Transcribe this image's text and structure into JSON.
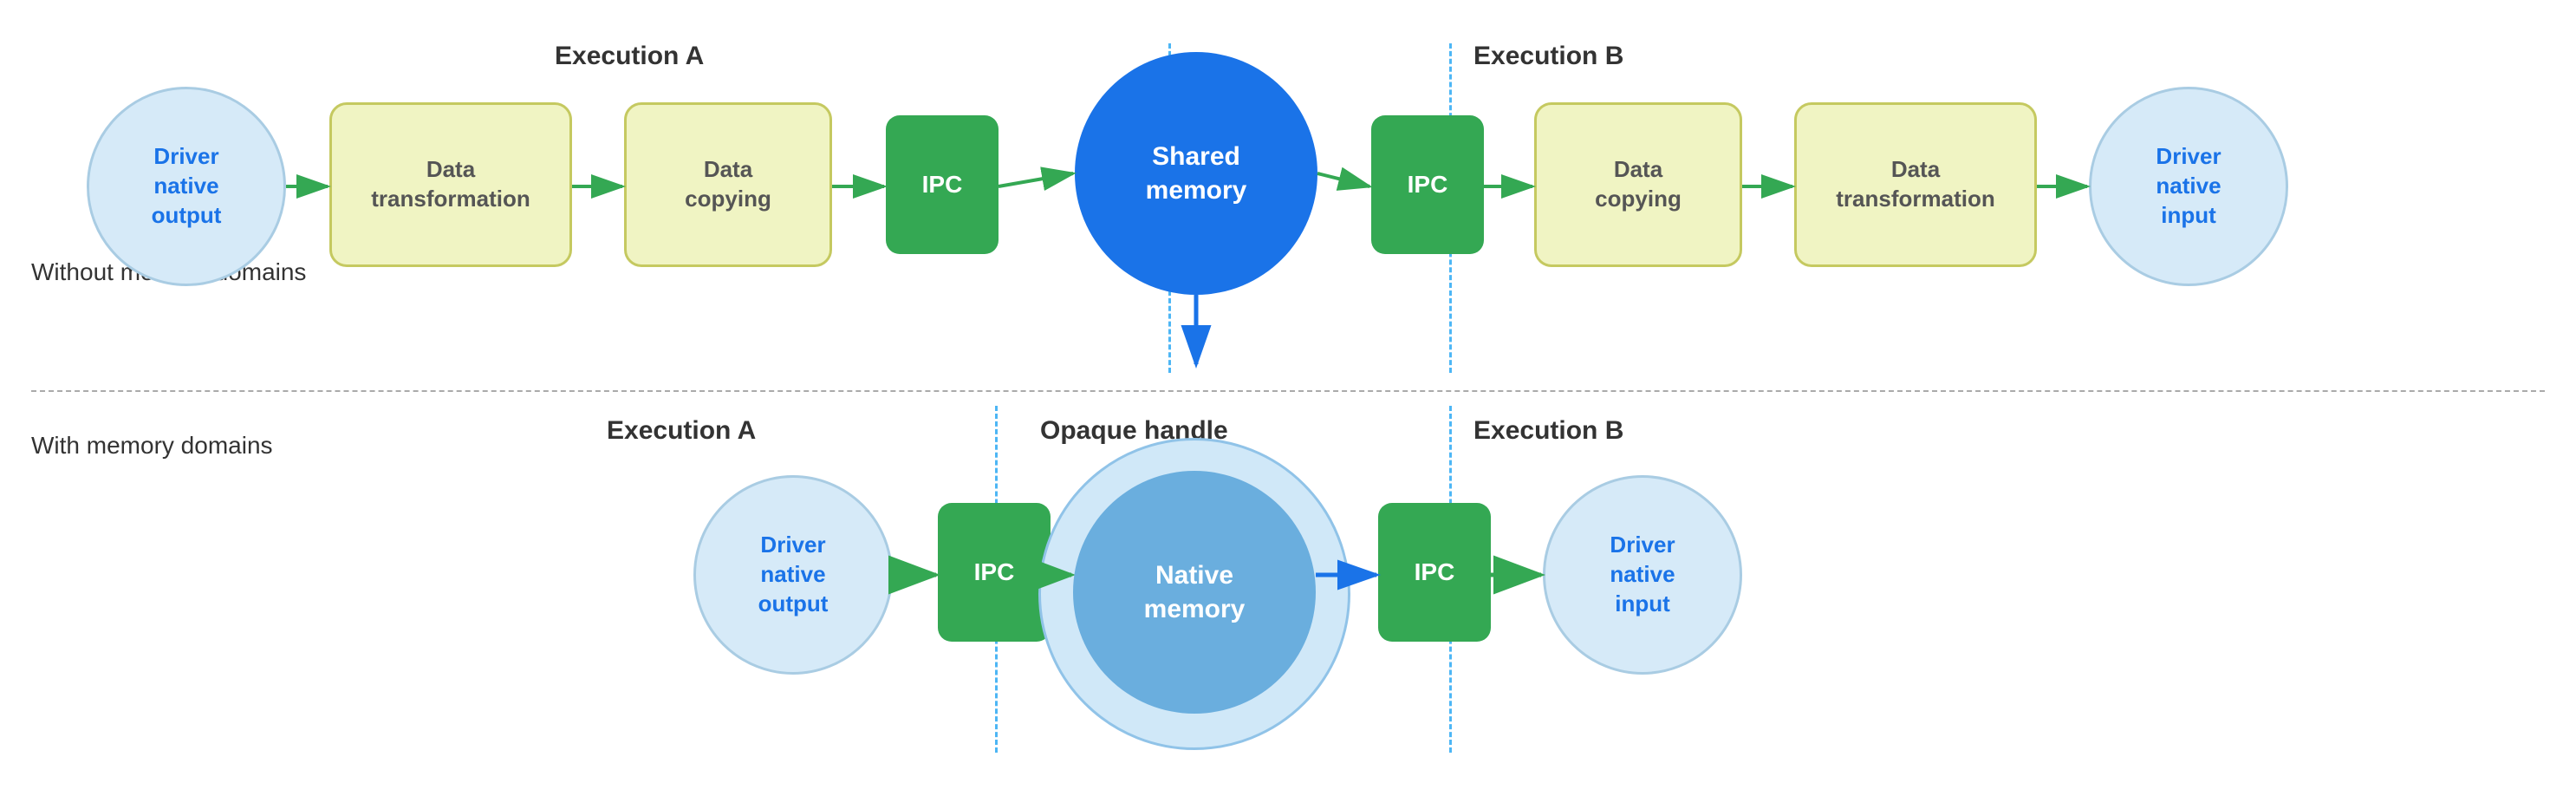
{
  "sections": {
    "without": "Without memory domains",
    "with": "With memory domains"
  },
  "top_row": {
    "exec_a_label": "Execution A",
    "exec_b_label": "Execution B",
    "nodes": [
      {
        "id": "driver_out_top",
        "label": "Driver\nnative\noutput",
        "type": "circle-light"
      },
      {
        "id": "data_transform_1",
        "label": "Data\ntransformation",
        "type": "rounded-yellow"
      },
      {
        "id": "data_copy_1",
        "label": "Data\ncopying",
        "type": "rounded-yellow"
      },
      {
        "id": "ipc_1",
        "label": "IPC",
        "type": "rounded-green"
      },
      {
        "id": "shared_memory",
        "label": "Shared\nmemory",
        "type": "circle-blue"
      },
      {
        "id": "ipc_2",
        "label": "IPC",
        "type": "rounded-green"
      },
      {
        "id": "data_copy_2",
        "label": "Data\ncopying",
        "type": "rounded-yellow"
      },
      {
        "id": "data_transform_2",
        "label": "Data\ntransformation",
        "type": "rounded-yellow"
      },
      {
        "id": "driver_in_top",
        "label": "Driver\nnative\ninput",
        "type": "circle-light"
      }
    ]
  },
  "bottom_row": {
    "exec_a_label": "Execution A",
    "exec_b_label": "Execution B",
    "opaque_label": "Opaque handle",
    "nodes": [
      {
        "id": "driver_out_bot",
        "label": "Driver\nnative\noutput",
        "type": "circle-light"
      },
      {
        "id": "ipc_3",
        "label": "IPC",
        "type": "rounded-green"
      },
      {
        "id": "native_memory",
        "label": "Native\nmemory",
        "type": "circle-blue-light"
      },
      {
        "id": "ipc_4",
        "label": "IPC",
        "type": "rounded-green"
      },
      {
        "id": "driver_in_bot",
        "label": "Driver\nnative\ninput",
        "type": "circle-light"
      }
    ]
  },
  "colors": {
    "circle_light_bg": "#d6eaf8",
    "circle_light_border": "#a9cce3",
    "circle_blue_bg": "#1a73e8",
    "circle_blue_light_bg": "#b3d4f5",
    "green_bg": "#34a853",
    "yellow_bg": "#f0f4c3",
    "yellow_border": "#c5c960",
    "arrow_green": "#34a853",
    "arrow_blue": "#1a73e8",
    "dotted_blue": "#4db6f5"
  }
}
